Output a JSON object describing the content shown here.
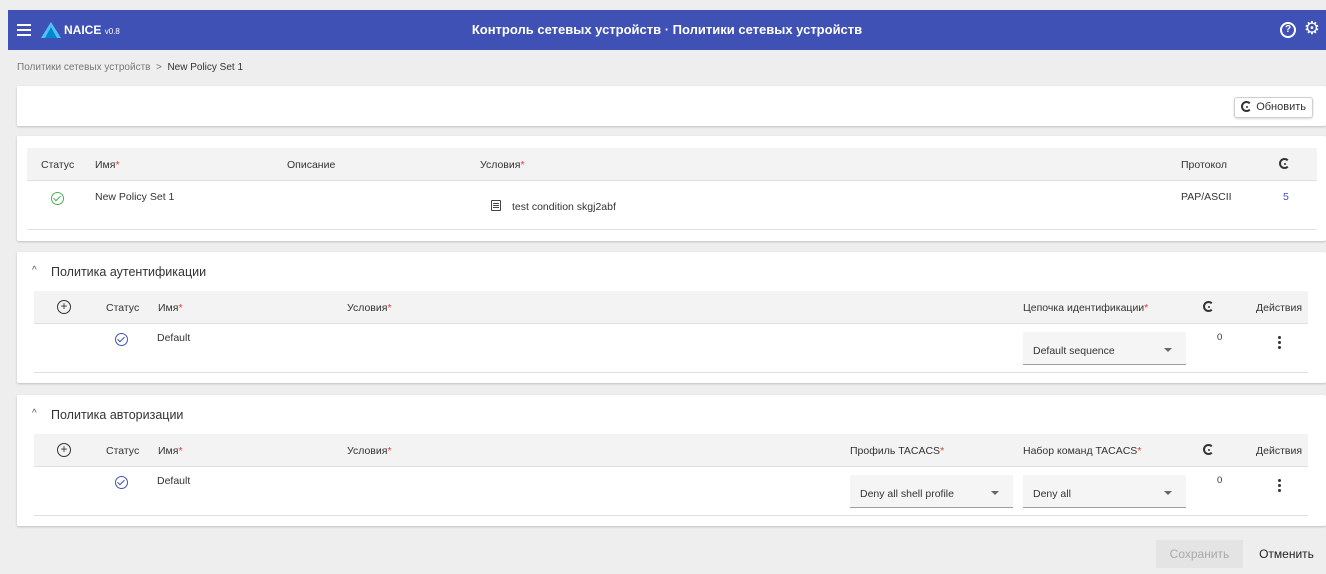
{
  "header": {
    "brand": "NAICE",
    "version": "v0.8",
    "title": "Контроль сетевых устройств · Политики сетевых устройств",
    "help_glyph": "?",
    "settings_glyph": "⚙"
  },
  "breadcrumb": {
    "parent": "Политики сетевых устройств",
    "separator": ">",
    "current": "New Policy Set 1"
  },
  "toolbar": {
    "refresh_label": "Обновить"
  },
  "policy_set": {
    "columns": {
      "status": "Статус",
      "name": "Имя",
      "description": "Описание",
      "conditions": "Условия",
      "protocol": "Протокол"
    },
    "row": {
      "name": "New Policy Set 1",
      "description": "",
      "condition": "test condition skgj2abf",
      "protocol": "PAP/ASCII",
      "hits": "5"
    }
  },
  "authentication": {
    "title": "Политика аутентификации",
    "columns": {
      "status": "Статус",
      "name": "Имя",
      "conditions": "Условия",
      "chain": "Цепочка идентификации",
      "actions": "Действия"
    },
    "row": {
      "name": "Default",
      "chain_value": "Default sequence",
      "hits": "0"
    }
  },
  "authorization": {
    "title": "Политика авторизации",
    "columns": {
      "status": "Статус",
      "name": "Имя",
      "conditions": "Условия",
      "profile": "Профиль TACACS",
      "commands": "Набор команд TACACS",
      "actions": "Действия"
    },
    "row": {
      "name": "Default",
      "profile_value": "Deny all shell profile",
      "commands_value": "Deny all",
      "hits": "0"
    }
  },
  "footer": {
    "save_label": "Сохранить",
    "cancel_label": "Отменить"
  },
  "common": {
    "required_mark": "*",
    "chevron": "^",
    "plus": "+"
  },
  "colors": {
    "header": "#3f51b5",
    "accent": "#3f51b5",
    "status_ok": "#4caf50",
    "required": "#e53935"
  }
}
